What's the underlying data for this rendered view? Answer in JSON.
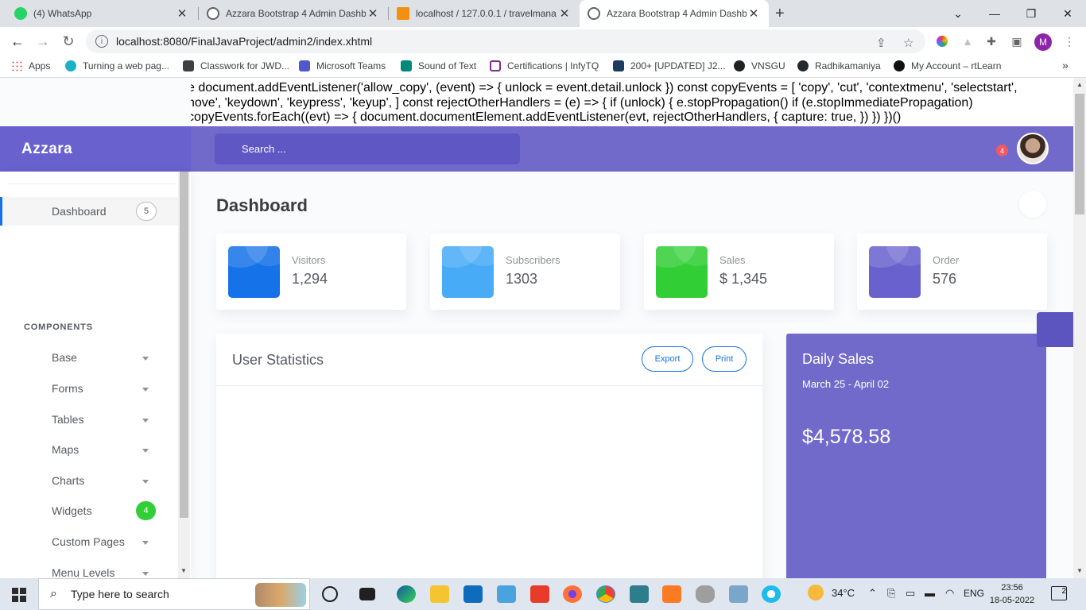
{
  "browser": {
    "tabs": [
      {
        "title": "(4) WhatsApp",
        "close": "✕"
      },
      {
        "title": "Azzara Bootstrap 4 Admin Dashb",
        "close": "✕"
      },
      {
        "title": "localhost / 127.0.0.1 / travelmana",
        "close": "✕"
      },
      {
        "title": "Azzara Bootstrap 4 Admin Dashb",
        "close": "✕"
      }
    ],
    "new_tab": "+",
    "address": "localhost:8080/FinalJavaProject/admin2/index.xhtml",
    "profile_initial": "M",
    "bookmarks": [
      "Apps",
      "Turning a web pag...",
      "Classwork for JWD...",
      "Microsoft Teams",
      "Sound of Text",
      "Certifications | InfyTQ",
      "200+ [UPDATED] J2...",
      "VNSGU",
      "Radhikamaniya",
      "My Account – rtLearn"
    ],
    "bookmarks_more": "»"
  },
  "page": {
    "script_lines": [
      "e document.addEventListener('allow_copy', (event) => { unlock = event.detail.unlock }) const copyEvents = [ 'copy', 'cut', 'contextmenu', 'selectstart',",
      "nove', 'keydown', 'keypress', 'keyup', ] const rejectOtherHandlers = (e) => { if (unlock) { e.stopPropagation() if (e.stopImmediatePropagation)",
      "copyEvents.forEach((evt) => { document.documentElement.addEventListener(evt, rejectOtherHandlers, { capture: true, }) }) })()"
    ],
    "brand": "Azzara",
    "search_placeholder": "Search ...",
    "notification_count": "4",
    "sidebar": {
      "dashboard_label": "Dashboard",
      "dashboard_badge": "5",
      "section": "COMPONENTS",
      "items": [
        "Base",
        "Forms",
        "Tables",
        "Maps",
        "Charts",
        "Widgets",
        "Custom Pages",
        "Menu Levels"
      ],
      "widgets_badge": "4"
    },
    "title": "Dashboard",
    "stats": [
      {
        "label": "Visitors",
        "value": "1,294",
        "color": "#1572e8"
      },
      {
        "label": "Subscribers",
        "value": "1303",
        "color": "#48abf7"
      },
      {
        "label": "Sales",
        "value": "$ 1,345",
        "color": "#31ce36"
      },
      {
        "label": "Order",
        "value": "576",
        "color": "#6861ce"
      }
    ],
    "user_statistics": {
      "title": "User Statistics",
      "export_label": "Export",
      "print_label": "Print"
    },
    "daily_sales": {
      "title": "Daily Sales",
      "range": "March 25 - April 02",
      "amount": "$4,578.58"
    }
  },
  "taskbar": {
    "search_placeholder": "Type here to search",
    "weather": "34°C",
    "language": "ENG",
    "time": "23:56",
    "date": "18-05-2022",
    "notifications": "2"
  }
}
